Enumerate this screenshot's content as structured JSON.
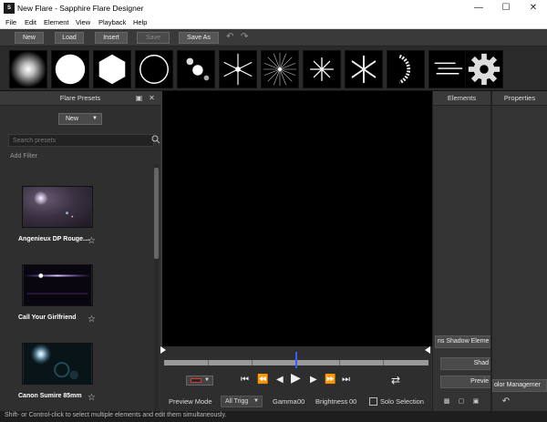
{
  "window": {
    "title": "New Flare - Sapphire Flare Designer",
    "app_icon": "S"
  },
  "menu": [
    "File",
    "Edit",
    "Element",
    "View",
    "Playback",
    "Help"
  ],
  "toolbar": {
    "new_label": "New",
    "load_label": "Load",
    "insert_label": "Insert",
    "save_label": "Save",
    "save_as_label": "Save As"
  },
  "element_strip": [
    "glow",
    "circle",
    "hexagon",
    "ring",
    "dots",
    "star",
    "radial-streaks",
    "spike-burst",
    "fan-rays",
    "arc",
    "streak-lines",
    "gear"
  ],
  "presets_panel": {
    "title": "Flare Presets",
    "new_label": "New",
    "search_placeholder": "Search presets",
    "add_filter_label": "Add Filter",
    "items": [
      {
        "label": "Angenieux DP Rouge...."
      },
      {
        "label": "Call Your Girlfriend"
      },
      {
        "label": "Canon Sumire 85mm"
      }
    ]
  },
  "preview": {
    "mode_label": "Preview Mode",
    "trigger_value": "All Trigg",
    "gamma_label": "Gamma",
    "gamma_value": "00",
    "brightness_label": "Brightness",
    "brightness_value": "00",
    "solo_label": "Solo Selection"
  },
  "elements_panel": {
    "title": "Elements",
    "shadow_btn": "ns Shadow Eleme",
    "shad_btn": "Shad",
    "preview_btn": "Previe"
  },
  "properties_panel": {
    "title": "Properties",
    "color_mgmt_btn": "olor Managemer"
  },
  "status": "Shift- or Control-click to select multiple elements and edit them simultaneously.",
  "colors": {
    "accent": "#3a5cff",
    "panel": "#2f2f2f",
    "viewport": "#000000"
  }
}
